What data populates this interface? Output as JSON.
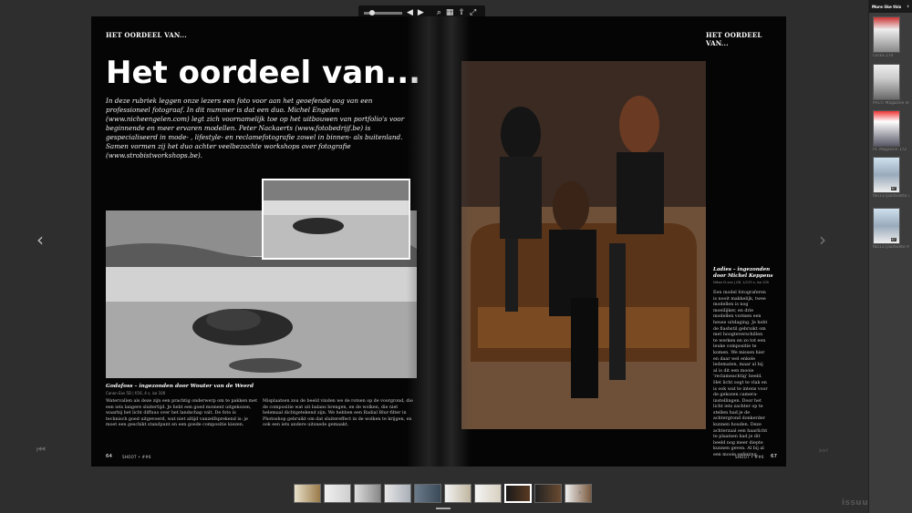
{
  "toolbar": {
    "prev_icon": "◀",
    "next_icon": "▶",
    "search_icon": "⌕",
    "grid_icon": "▦",
    "share_icon": "⇪",
    "fullscreen_icon": "⤢",
    "zoom_level": 0.15
  },
  "magazine": {
    "section_left": "HET OORDEEL VAN...",
    "section_right": "HET OORDEEL VAN...",
    "headline": "Het oordeel van...",
    "intro": "In deze rubriek leggen onze lezers een foto voor aan het geoefende oog van een professioneel fotograaf. In dit nummer is dat een duo. Michel Engelen (www.nicheengelen.com) legt zich voornamelijk toe op het uitbouwen van portfolio's voor beginnende en meer ervaren modellen. Peter Nackaerts (www.fotobedrijf.be) is gespecialiseerd in mode- , lifestyle- en reclamefotografie zowel in binnen- als buitenland. Samen vormen zij het duo achter veelbezochte workshops over fotografie (www.strobistworkshops.be).",
    "caption_left": "Godafoss – ingezonden door Wouter van de Weerd",
    "caption_left_meta": "Canon Eos 5D | f/16, 4 s, iso 100",
    "body_col1": "Watervallen als deze zijn een prachtig onderwerp om te pakken met een iets langere sluitertijd. Je hebt een goed moment uitgekozen, waarbij het licht diffuus over het landschap valt. De foto is technisch goed uitgevoerd, wat niet altijd vanzelfsprekend is: je moet een geschikt standpunt en een goede compositie kiezen.",
    "body_col2": "Misplaatsen zou de beeld vinden we de rotsen op de voorgrond, die de compositie wat uit balans brengen, en de wolken, die niet helemaal dichtgetekend zijn. We hebben een Radial Blur-filter in Photoshop gebruikt om dat sluitereffect in de wolken te krijgen, en ook een iets andere uitsnede gemaakt.",
    "folio_left": "64",
    "folio_left_mag": "SHOOT • ##6",
    "folio_right": "67",
    "folio_right_mag": "SHOOT • ##6",
    "side_caption": "Ladies – ingezonden door Michel Keppens",
    "side_meta": "Nikon D-xxx | f/8, 1/125 s, iso 100",
    "side_text": "Een model fotograferen is nooit makkelijk, twee modellen is nog moeilijker, en drie modellen vormen een heuse uitdaging. Je hebt de flashstil gebruikt om met hoogteverschillen te werken en zo tot een leuke compositie te komen. We missen hier en daar wel enkele ledematen, maar al bij al is dit een mooie 'reclameachtig' beeld. Het licht oogt te vlak en is ook wat te intens voor de gekozen camera-instellingen. Door het licht iets zachter op te stellen had je de achtergrond donkerder kunnen houden. Deze achterzaal een haarlicht te plaatsen had je dit beeld nog meer diepte kunnen geven. Al bij al een mooie oefening."
  },
  "nav": {
    "prev_page_icon": "‹",
    "next_page_icon": "›",
    "first_page_icon": "⏮",
    "last_page_icon": "⏭"
  },
  "thumbnails": {
    "count": 10,
    "active_index": 6,
    "next_icon": "›"
  },
  "brand": "issuu",
  "sidebar": {
    "title": "More like this",
    "arrow": "›",
    "items": [
      {
        "label": "Clickx 270"
      },
      {
        "label": "PriCIT Magazine 44",
        "badge": "44"
      },
      {
        "label": "PC Magazine 172"
      },
      {
        "label": "fbo137jaarboetta ug mei",
        "badge": "67"
      },
      {
        "label": "fbo137jaarboete mei",
        "badge": "67"
      }
    ]
  },
  "colors": {
    "background": "#2e2e2e",
    "page": "#050505",
    "sidebar": "#3c3c3c",
    "toolbar": "#111111"
  }
}
